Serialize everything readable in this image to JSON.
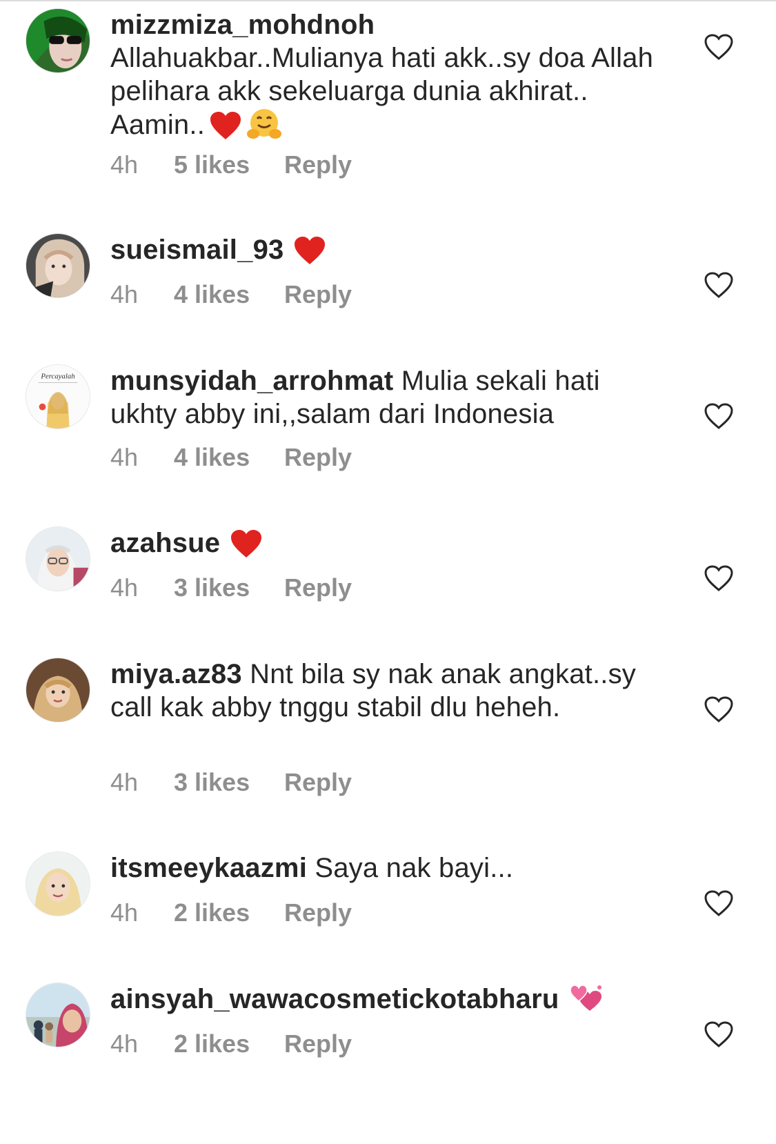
{
  "comments": [
    {
      "username": "mizzmiza_mohdnoh",
      "text": "Allahuakbar..Mulianya hati akk..sy doa Allah pelihara akk sekeluarga dunia akhirat.. Aamin..",
      "emojis": [
        "red-heart",
        "hugging-face"
      ],
      "time": "4h",
      "likes": "5 likes",
      "reply": "Reply"
    },
    {
      "username": "sueismail_93",
      "text": "",
      "emojis": [
        "red-heart"
      ],
      "time": "4h",
      "likes": "4 likes",
      "reply": "Reply"
    },
    {
      "username": "munsyidah_arrohmat",
      "text": "Mulia sekali hati ukhty abby ini,,salam dari Indonesia",
      "emojis": [],
      "avatar_text": "Percayalah",
      "time": "4h",
      "likes": "4 likes",
      "reply": "Reply"
    },
    {
      "username": "azahsue",
      "text": "",
      "emojis": [
        "red-heart"
      ],
      "time": "4h",
      "likes": "3 likes",
      "reply": "Reply"
    },
    {
      "username": "miya.az83",
      "text": "Nnt bila sy nak anak angkat..sy call kak abby tnggu stabil dlu heheh.",
      "emojis": [],
      "time": "4h",
      "likes": "3 likes",
      "reply": "Reply"
    },
    {
      "username": "itsmeeykaazmi",
      "text": "Saya nak bayi...",
      "emojis": [],
      "time": "4h",
      "likes": "2 likes",
      "reply": "Reply"
    },
    {
      "username": "ainsyah_wawacosmetickotabharu",
      "text": "",
      "emojis": [
        "two-hearts"
      ],
      "time": "4h",
      "likes": "2 likes",
      "reply": "Reply"
    }
  ],
  "colors": {
    "text": "#262626",
    "meta": "#8e8e8e",
    "red_heart": "#e0231f",
    "like_icon": "#262626"
  }
}
